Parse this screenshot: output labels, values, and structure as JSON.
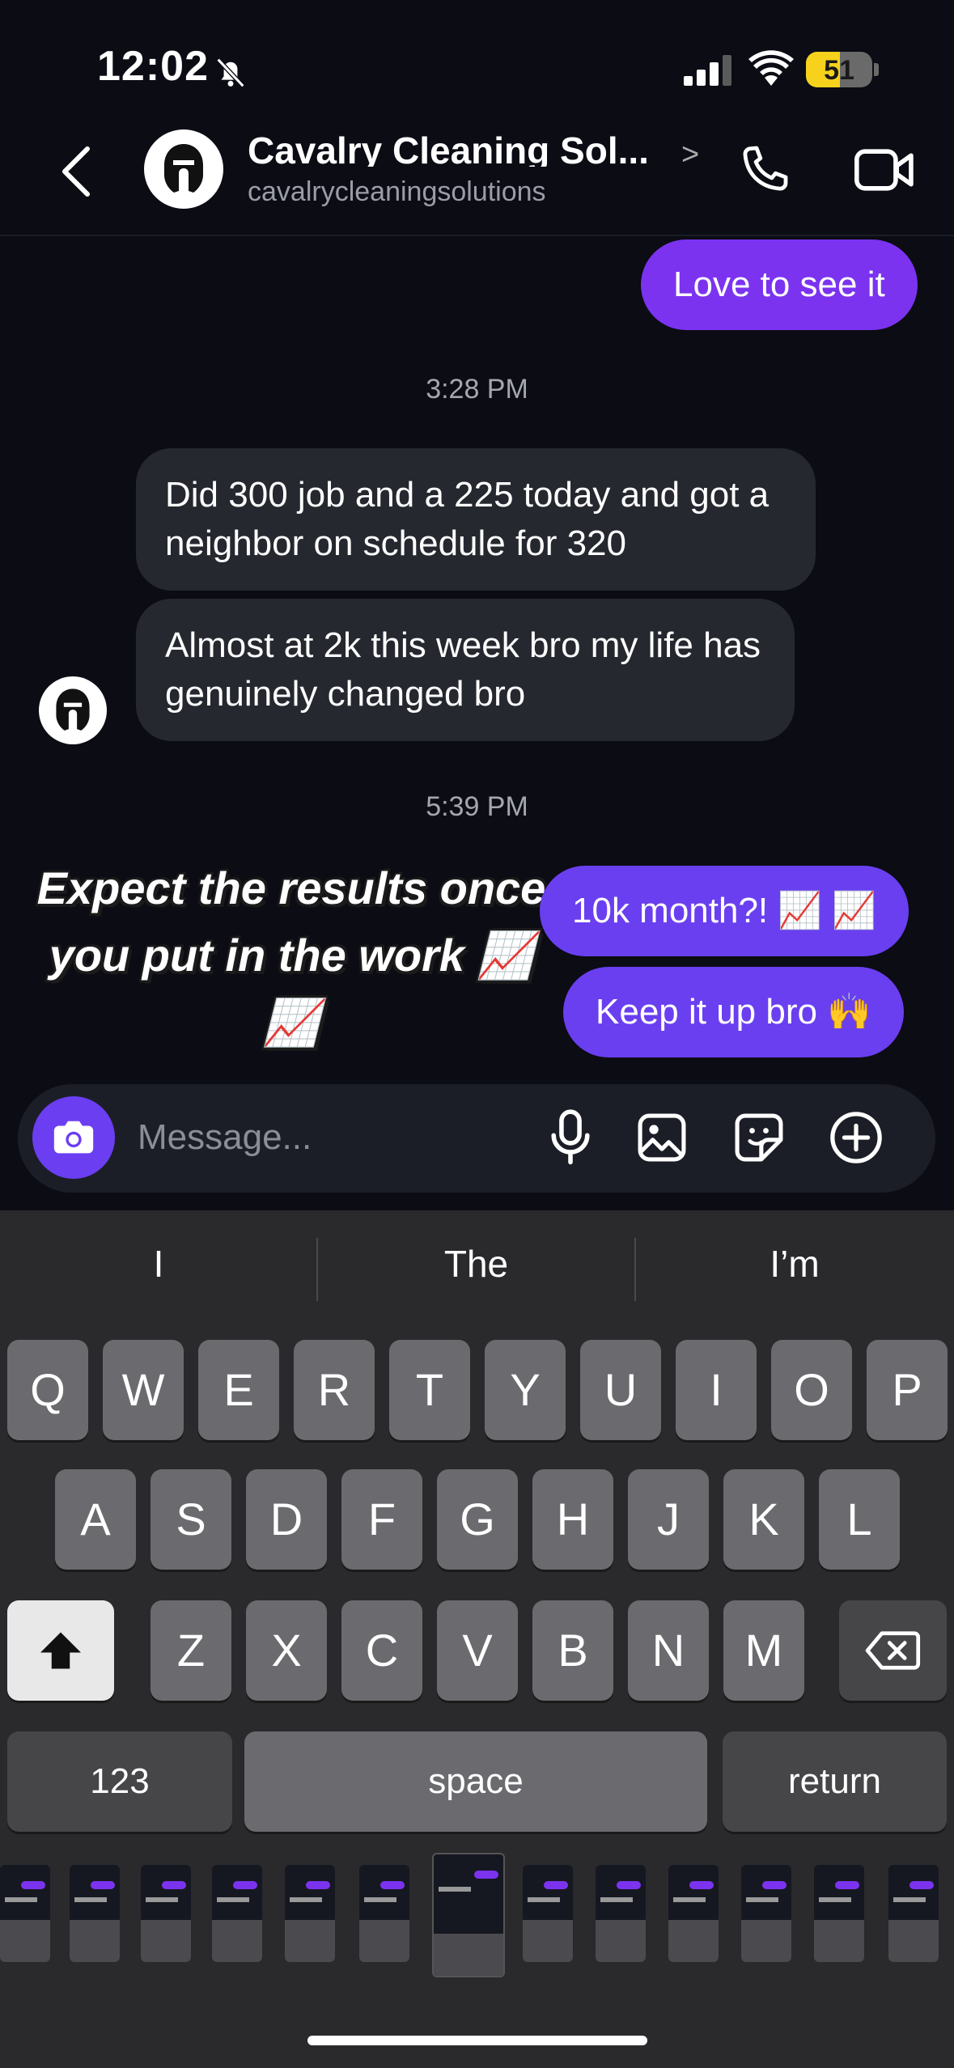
{
  "status_bar": {
    "time": "12:02",
    "battery": "51",
    "battery_level": 0.51
  },
  "header": {
    "name": "Cavalry Cleaning Sol...",
    "handle": "cavalrycleaningsolutions",
    "chevron": ">"
  },
  "messages": {
    "out_1": "Love to see it",
    "ts_1": "3:28 PM",
    "in_1": "Did 300 job and a 225 today and got a neighbor on schedule for 320",
    "in_2": "Almost at 2k this week bro my life has genuinely changed bro",
    "ts_2": "5:39 PM",
    "sticker_text": "Expect the results once you put in the work 📈📈",
    "out_2": "10k month?! 📈 📈",
    "out_3": "Keep it up bro 🙌"
  },
  "composer": {
    "placeholder": "Message..."
  },
  "keyboard": {
    "suggestions": [
      "I",
      "The",
      "I’m"
    ],
    "row1": [
      "Q",
      "W",
      "E",
      "R",
      "T",
      "Y",
      "U",
      "I",
      "O",
      "P"
    ],
    "row2": [
      "A",
      "S",
      "D",
      "F",
      "G",
      "H",
      "J",
      "K",
      "L"
    ],
    "row3": [
      "Z",
      "X",
      "C",
      "V",
      "B",
      "N",
      "M"
    ],
    "numbers_label": "123",
    "space_label": "space",
    "return_label": "return"
  },
  "icons": [
    "back-chevron-icon",
    "phone-icon",
    "video-icon",
    "camera-icon",
    "microphone-icon",
    "image-icon",
    "sticker-icon",
    "plus-icon",
    "bell-slash-icon",
    "signal-icon",
    "wifi-icon",
    "shift-icon",
    "backspace-icon"
  ],
  "colors": {
    "outgoing": "#7b33f0",
    "outgoing_alt": "#6a3ff0",
    "incoming": "#262830",
    "background": "#0b0c14",
    "battery": "#f6d21c"
  }
}
